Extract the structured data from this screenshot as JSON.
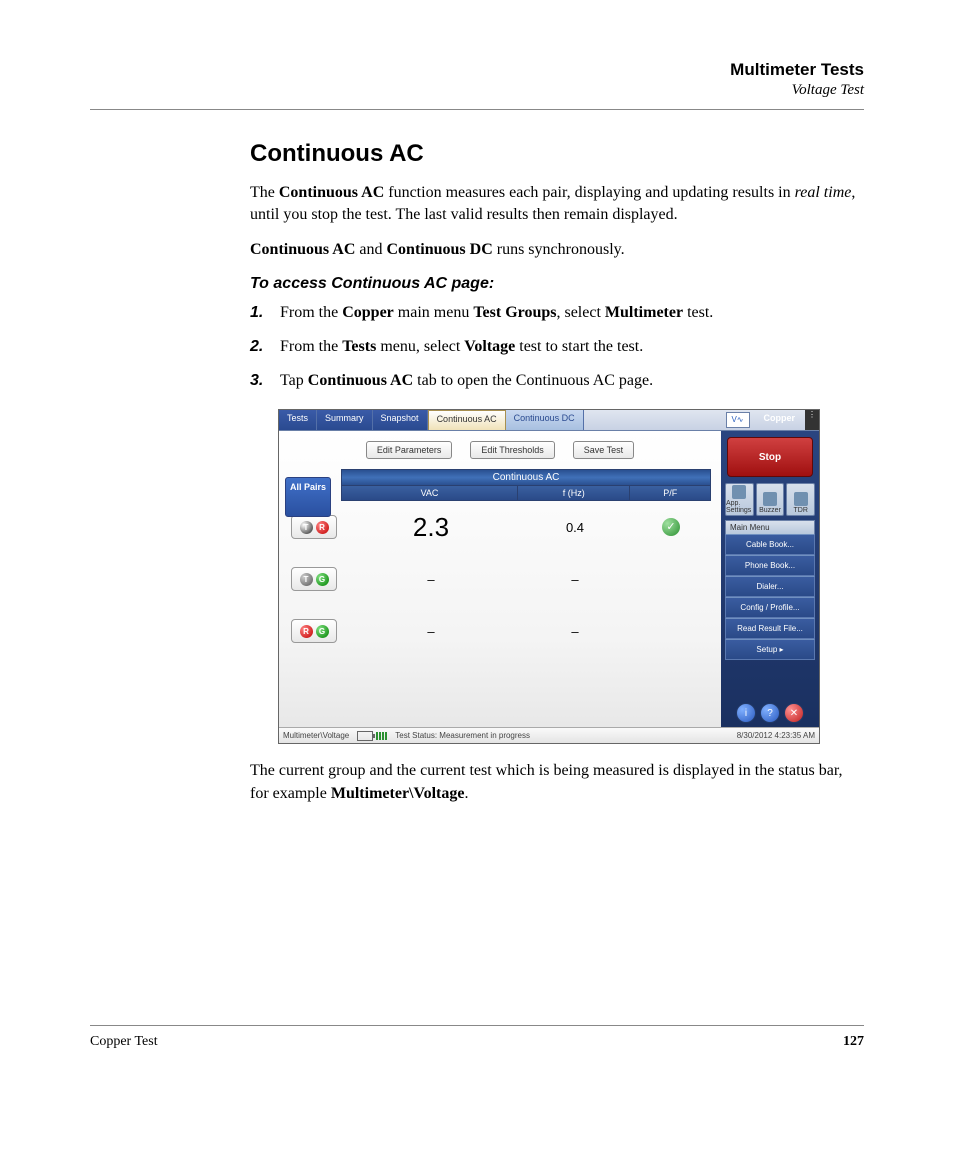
{
  "header": {
    "title": "Multimeter Tests",
    "subtitle": "Voltage Test"
  },
  "section_heading": "Continuous AC",
  "intro": {
    "p1_a": "The ",
    "p1_b": "Continuous AC",
    "p1_c": " function measures each pair, displaying and updating results in ",
    "p1_d": "real time",
    "p1_e": ", until you stop the test. The last valid results then remain displayed.",
    "p2_a": "Continuous AC",
    "p2_b": " and ",
    "p2_c": "Continuous DC",
    "p2_d": " runs synchronously."
  },
  "access_heading": "To access Continuous AC page:",
  "steps": {
    "s1": {
      "n": "1.",
      "a": "From the ",
      "b": "Copper",
      "c": " main menu ",
      "d": "Test Groups",
      "e": ", select ",
      "f": "Multimeter",
      "g": " test."
    },
    "s2": {
      "n": "2.",
      "a": "From the ",
      "b": "Tests",
      "c": " menu, select ",
      "d": "Voltage",
      "e": " test to start the test."
    },
    "s3": {
      "n": "3.",
      "a": "Tap ",
      "b": "Continuous AC",
      "c": " tab to open the Continuous AC page."
    }
  },
  "post": {
    "a": "The current group and the current test which is being measured is displayed in the status bar, for example ",
    "b": "Multimeter\\Voltage",
    "c": "."
  },
  "footer": {
    "left": "Copper Test",
    "page": "127"
  },
  "ui": {
    "tabs": {
      "tests": "Tests",
      "summary": "Summary",
      "snapshot": "Snapshot",
      "cont_ac": "Continuous AC",
      "cont_dc": "Continuous DC"
    },
    "top_icon": "V∿",
    "copper": "Copper",
    "toolbar": {
      "edit_params": "Edit Parameters",
      "edit_thresh": "Edit Thresholds",
      "save_test": "Save Test"
    },
    "all_pairs": "All Pairs",
    "table_title": "Continuous AC",
    "columns": {
      "vac": "VAC",
      "fhz": "f (Hz)",
      "pf": "P/F"
    },
    "rows": [
      {
        "pair": [
          "T",
          "R"
        ],
        "vac": "2.3",
        "fhz": "0.4",
        "pf": "pass"
      },
      {
        "pair": [
          "T",
          "G"
        ],
        "vac": "–",
        "fhz": "–",
        "pf": ""
      },
      {
        "pair": [
          "R",
          "G"
        ],
        "vac": "–",
        "fhz": "–",
        "pf": ""
      }
    ],
    "side": {
      "stop": "Stop",
      "tools": {
        "app": "App. Settings",
        "buzzer": "Buzzer",
        "tdr": "TDR"
      },
      "menu_head": "Main Menu",
      "menu": [
        "Cable Book...",
        "Phone Book...",
        "Dialer...",
        "Config / Profile...",
        "Read Result File...",
        "Setup     ▸"
      ]
    },
    "status": {
      "path": "Multimeter\\Voltage",
      "msg": "Test Status: Measurement in progress",
      "time": "8/30/2012 4:23:35 AM"
    }
  }
}
